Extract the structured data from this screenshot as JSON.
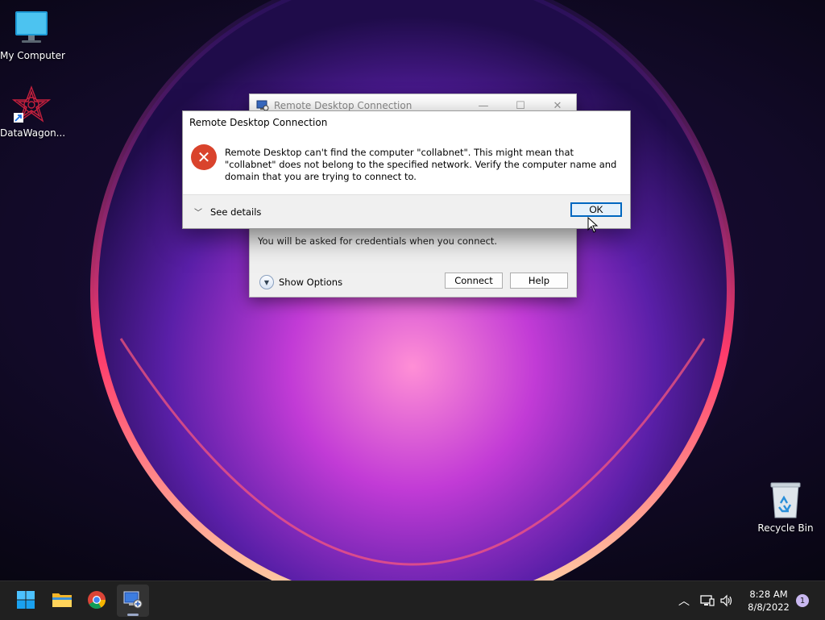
{
  "desktop": {
    "icons": [
      {
        "label": "My Computer",
        "icon": "monitor-icon"
      },
      {
        "label": "DataWagon...",
        "icon": "datawagon-icon"
      },
      {
        "label": "Recycle Bin",
        "icon": "recycle-bin-icon"
      }
    ]
  },
  "rdc_window": {
    "title": "Remote Desktop Connection",
    "credentials_note": "You will be asked for credentials when you connect.",
    "show_options_label": "Show Options",
    "connect_label": "Connect",
    "help_label": "Help"
  },
  "error_dialog": {
    "title": "Remote Desktop Connection",
    "message": "Remote Desktop can't find the computer \"collabnet\". This might mean that \"collabnet\" does not belong to the specified network.  Verify the computer name and domain that you are trying to connect to.",
    "see_details_label": "See details",
    "ok_label": "OK",
    "icon": "error-icon",
    "colors": {
      "error": "#d9432c",
      "accent": "#0067c0"
    }
  },
  "taskbar": {
    "apps": [
      {
        "name": "Start",
        "icon": "windows-start-icon"
      },
      {
        "name": "File Explorer",
        "icon": "folder-icon"
      },
      {
        "name": "Google Chrome",
        "icon": "chrome-icon"
      },
      {
        "name": "Remote Desktop Connection",
        "icon": "remote-desktop-icon",
        "active": true
      }
    ],
    "tray": {
      "time": "8:28 AM",
      "date": "8/8/2022",
      "notification_count": "1"
    }
  }
}
